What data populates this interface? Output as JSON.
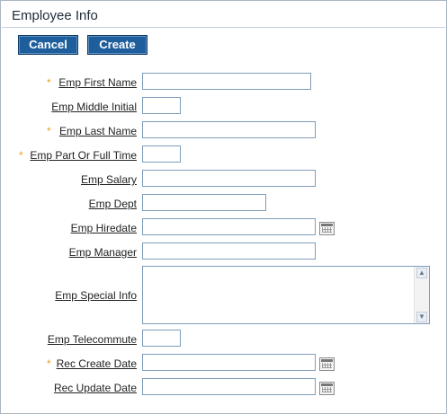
{
  "panel": {
    "title": "Employee Info"
  },
  "buttons": {
    "cancel": "Cancel",
    "create": "Create"
  },
  "required_marker": "*",
  "fields": {
    "first_name": {
      "label": "Emp First Name",
      "value": ""
    },
    "middle_init": {
      "label": "Emp Middle Initial",
      "value": ""
    },
    "last_name": {
      "label": "Emp Last Name",
      "value": ""
    },
    "part_full": {
      "label": "Emp Part Or Full Time",
      "value": ""
    },
    "salary": {
      "label": "Emp Salary",
      "value": ""
    },
    "dept": {
      "label": "Emp Dept",
      "value": ""
    },
    "hiredate": {
      "label": "Emp Hiredate",
      "value": ""
    },
    "manager": {
      "label": "Emp Manager",
      "value": ""
    },
    "special_info": {
      "label": "Emp Special Info",
      "value": ""
    },
    "telecommute": {
      "label": "Emp Telecommute",
      "value": ""
    },
    "rec_create": {
      "label": "Rec Create Date",
      "value": ""
    },
    "rec_update": {
      "label": "Rec Update Date",
      "value": ""
    }
  },
  "icons": {
    "calendar": "calendar-icon"
  },
  "colors": {
    "button_bg": "#1f5e9c",
    "required": "#f0a020",
    "input_border": "#7f9db9"
  }
}
